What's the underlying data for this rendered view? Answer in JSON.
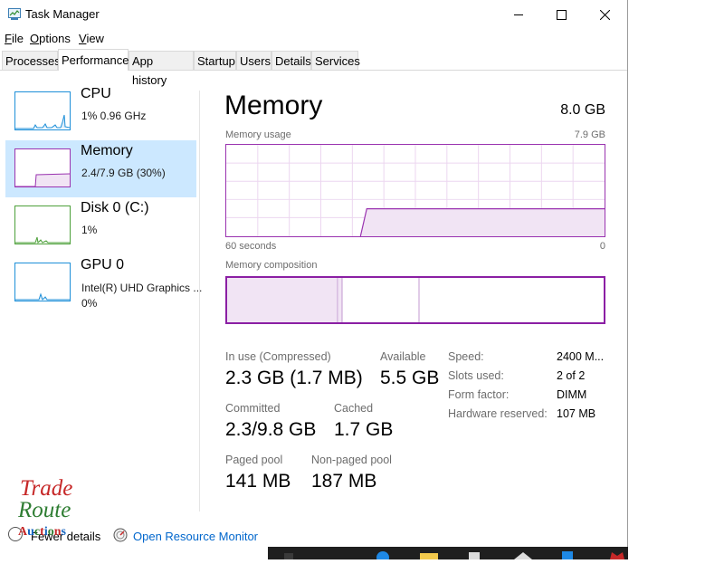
{
  "window": {
    "title": "Task Manager"
  },
  "menu": [
    {
      "label": "File",
      "key": "F",
      "rest": "ile"
    },
    {
      "label": "Options",
      "key": "O",
      "rest": "ptions"
    },
    {
      "label": "View",
      "key": "V",
      "rest": "iew"
    }
  ],
  "tabs": [
    "Processes",
    "Performance",
    "App history",
    "Startup",
    "Users",
    "Details",
    "Services"
  ],
  "active_tab": "Performance",
  "sidebar": [
    {
      "name": "CPU",
      "sub1": "1%  0.96 GHz",
      "sub2": "",
      "color": "#1d8fd8",
      "selected": false
    },
    {
      "name": "Memory",
      "sub1": "2.4/7.9 GB (30%)",
      "sub2": "",
      "color": "#9a33b0",
      "selected": true
    },
    {
      "name": "Disk 0 (C:)",
      "sub1": "1%",
      "sub2": "",
      "color": "#4da03a",
      "selected": false
    },
    {
      "name": "GPU 0",
      "sub1": "Intel(R) UHD Graphics ...",
      "sub2": "0%",
      "color": "#1d8fd8",
      "selected": false
    }
  ],
  "main": {
    "title": "Memory",
    "total": "8.0 GB",
    "usage_label": "Memory usage",
    "usage_max": "7.9 GB",
    "time_left": "60 seconds",
    "time_right": "0",
    "composition_label": "Memory composition",
    "usage_fraction_now": 0.3,
    "stats": {
      "in_use_label": "In use (Compressed)",
      "in_use_value": "2.3 GB (1.7 MB)",
      "available_label": "Available",
      "available_value": "5.5 GB",
      "committed_label": "Committed",
      "committed_value": "2.3/9.8 GB",
      "cached_label": "Cached",
      "cached_value": "1.7 GB",
      "paged_label": "Paged pool",
      "paged_value": "141 MB",
      "nonpaged_label": "Non-paged pool",
      "nonpaged_value": "187 MB"
    },
    "details": [
      {
        "label": "Speed:",
        "value": "2400 M..."
      },
      {
        "label": "Slots used:",
        "value": "2 of 2"
      },
      {
        "label": "Form factor:",
        "value": "DIMM"
      },
      {
        "label": "Hardware reserved:",
        "value": "107 MB"
      }
    ]
  },
  "footer": {
    "fewer_details": "Fewer details",
    "open_resource_monitor": "Open Resource Monitor"
  },
  "watermark": {
    "line1": "Trade",
    "line2": "Route",
    "line3": "Auctions"
  },
  "colors": {
    "memory_accent": "#9a33b0",
    "selected_bg": "#cce8ff",
    "link": "#0066cc"
  }
}
